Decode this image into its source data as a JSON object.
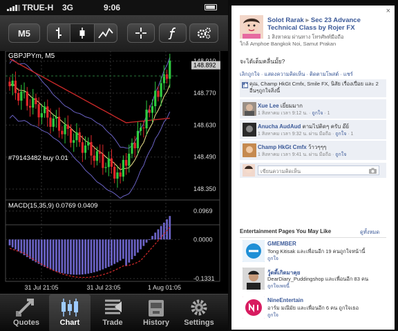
{
  "status_bar": {
    "carrier": "TRUE-H",
    "network": "3G",
    "time": "9:06"
  },
  "toolbar": {
    "timeframe": "M5"
  },
  "chart": {
    "symbol_label": "GBPJPYm, M5",
    "order_label": "#79143482 buy 0.01",
    "price_ticks": [
      "148.910",
      "148.770",
      "148.630",
      "148.490",
      "148.350"
    ],
    "current_price": "148.892",
    "macd_label": "MACD(15,35,9) 0.0769 0.0409",
    "macd_ticks": [
      "0.0969",
      "0.0000",
      "-0.1331"
    ],
    "time_labels": [
      "31 Jul 21:05",
      "31 Jul 23:05",
      "1 Aug 01:05"
    ],
    "colors": {
      "bull": "#2ecc40",
      "bear": "#e0262a",
      "ma_red": "#c62828",
      "ma_yellow": "#f0e68c",
      "band": "#6a62c4",
      "macd_hist": "#6a62c4",
      "macd_signal": "#c62828",
      "current_price_bg": "#c9c9c9"
    }
  },
  "tabs": [
    {
      "label": "Quotes",
      "icon": "quotes-arrows-icon"
    },
    {
      "label": "Chart",
      "icon": "chart-candles-icon"
    },
    {
      "label": "Trade",
      "icon": "trade-list-icon"
    },
    {
      "label": "History",
      "icon": "history-box-icon"
    },
    {
      "label": "Settings",
      "icon": "settings-gear-icon"
    }
  ],
  "facebook": {
    "close": "×",
    "post": {
      "author": "Solot Rarak",
      "arrow": "▸",
      "group": "Sec 23 Advance Technical Class by Rojer FX",
      "meta": "1 สิงหาคม ผ่านทาง โทรศัพท์มือถือ",
      "location": "ใกล้ Amphoe Bangkok Noi, Samut Prakan",
      "message": "จะได้เต็มคลื่นมั้ย?",
      "actions": "เลิกถูกใจ · แสดงความคิดเห็น · ติดตามโพสต์ · แชร์",
      "likes": "คุณ, Champ HkGt Cmfx, Smile FX, นิสัย เรื่องเปื่อย และ 2 อื่นๆถูกใจสิ่งนี้"
    },
    "comments": [
      {
        "name": "Xue Lee",
        "text": "เยี่ยมมาก",
        "meta": "1 สิงหาคม เวลา 9:12 น. · ",
        "like_link": "ถูกใจ",
        "likes": "1"
      },
      {
        "name": "Anucha AudAud",
        "text": "ตามไปติดๆ ครับ อ๊ย์",
        "meta": "1 สิงหาคม เวลา 9:32 น. ผ่าน มือถือ · ",
        "like_link": "ถูกใจ",
        "likes": "1"
      },
      {
        "name": "Champ HkGt Cmfx",
        "text": "ว้าวๆๆๆ",
        "meta": "1 สิงหาคม เวลา 9:41 น. ผ่าน มือถือ · ",
        "like_link": "ถูกใจ",
        "likes": ""
      }
    ],
    "comment_placeholder": "เขียนความคิดเห็น",
    "entertainment": {
      "heading": "Entertainment Pages You May Like",
      "see_all": "ดูทั้งหมด",
      "pages": [
        {
          "name": "GMEMBER",
          "desc": "Tong Kitisak และเพื่อนอีก 19 คนถูกใจหน้านี้",
          "like": "ถูกใจ"
        },
        {
          "name": "วู้ดดี้เกิดมาคุย",
          "desc": "DearDiary_Puddingshop และเพื่อนอีก 83 คน",
          "like": "ถูกใจเพจนี้"
        },
        {
          "name": "NineEntertain",
          "desc": "อาร์ม มณีมัย และเพื่อนอีก 6 คน ถูกใจเธอ",
          "like": "ถูกใจ"
        }
      ]
    }
  }
}
